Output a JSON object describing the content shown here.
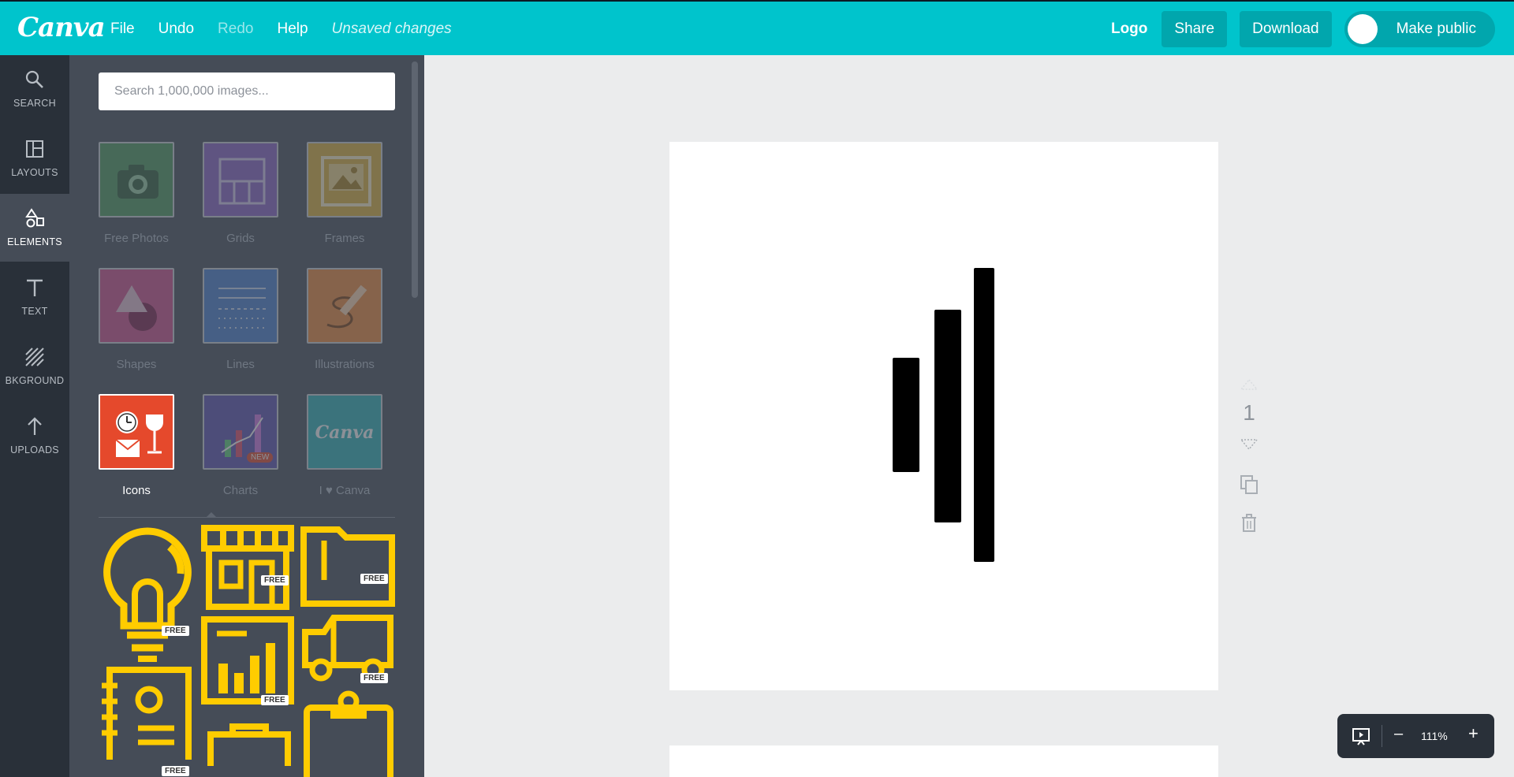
{
  "topbar": {
    "brand": "Canva",
    "menu": {
      "file": "File",
      "undo": "Undo",
      "redo": "Redo",
      "help": "Help",
      "status": "Unsaved changes"
    },
    "logo_label": "Logo",
    "share": "Share",
    "download": "Download",
    "make_public": "Make public"
  },
  "rail": {
    "items": [
      {
        "label": "SEARCH"
      },
      {
        "label": "LAYOUTS"
      },
      {
        "label": "ELEMENTS"
      },
      {
        "label": "TEXT"
      },
      {
        "label": "BKGROUND"
      },
      {
        "label": "UPLOADS"
      }
    ],
    "active": "ELEMENTS"
  },
  "panel": {
    "search_placeholder": "Search 1,000,000 images...",
    "categories": [
      {
        "label": "Free Photos"
      },
      {
        "label": "Grids"
      },
      {
        "label": "Frames"
      },
      {
        "label": "Shapes"
      },
      {
        "label": "Lines"
      },
      {
        "label": "Illustrations"
      },
      {
        "label": "Icons"
      },
      {
        "label": "Charts",
        "badge": "NEW"
      },
      {
        "label": "I ♥ Canva",
        "tile_text": "Canva"
      }
    ],
    "selected_category": "Icons",
    "free_badge": "FREE"
  },
  "canvas": {
    "page_number": "1"
  },
  "zoom": {
    "level": "111%",
    "minus": "–",
    "plus": "+"
  },
  "colors": {
    "accent": "#00c4cc",
    "rail": "#293039",
    "panel": "#454c57",
    "icon_yellow": "#ffcc00"
  }
}
